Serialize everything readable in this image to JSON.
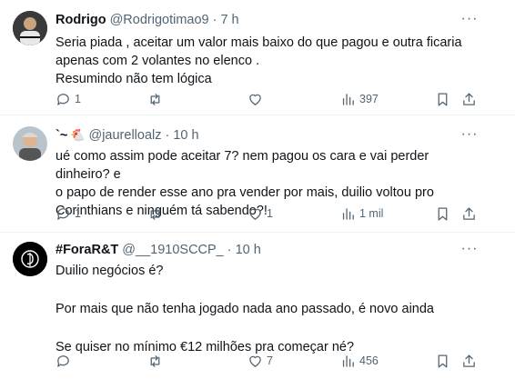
{
  "tweets": [
    {
      "name": "Rodrigo",
      "badge": "",
      "handle": "@Rodrigotimao9",
      "dot": "·",
      "time": "7 h",
      "text": "Seria piada , aceitar um valor mais baixo do que pagou e outra ficaria\napenas com 2 volantes no elenco .\nResumindo não tem lógica",
      "replies": "1",
      "retweets": "",
      "likes": "",
      "views": "397"
    },
    {
      "name": "`~",
      "badge": "🐔",
      "handle": "@jaurelloalz",
      "dot": "·",
      "time": "10 h",
      "text": "ué como assim pode aceitar 7? nem pagou os cara e vai perder dinheiro? e\no papo de render esse ano pra vender por mais, duilio voltou pro\nCorinthians e ninguém tá sabendo?!",
      "replies": "1",
      "retweets": "",
      "likes": "1",
      "views": "1 mil"
    },
    {
      "name": "#ForaR&T",
      "badge": "",
      "handle": "@__1910SCCP_",
      "dot": "·",
      "time": "10 h",
      "text": "Duilio negócios é?\n\nPor mais que não tenha jogado nada ano passado, é novo ainda\n\nSe quiser no mínimo €12 milhões pra começar né?",
      "replies": "",
      "retweets": "",
      "likes": "7",
      "views": "456"
    }
  ],
  "more_label": "···"
}
